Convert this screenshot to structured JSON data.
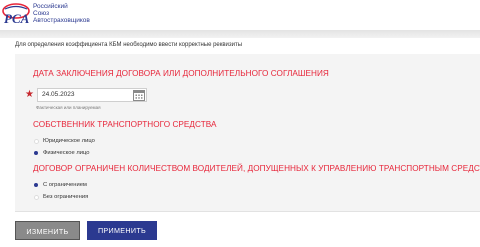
{
  "header": {
    "org_line1": "Российский",
    "org_line2": "Союз",
    "org_line3": "Автостраховщиков",
    "logo_colors": {
      "blue": "#2b3990",
      "red": "#e7263a"
    }
  },
  "intro_text": "Для определения коэффициента КБМ необходимо ввести корректные реквизиты",
  "section_contract": {
    "title": "ДАТА ЗАКЛЮЧЕНИЯ ДОГОВОРА ИЛИ ДОПОЛНИТЕЛЬНОГО СОГЛАШЕНИЯ",
    "required_mark": "★",
    "date_value": "24.05.2023",
    "date_hint": "Фактическая или планируемая"
  },
  "section_owner": {
    "title": "СОБСТВЕННИК ТРАНСПОРТНОГО СРЕДСТВА",
    "options": [
      {
        "label": "Юридическое лицо",
        "selected": false
      },
      {
        "label": "Физическое лицо",
        "selected": true
      }
    ]
  },
  "section_drivers": {
    "title": "ДОГОВОР ОГРАНИЧЕН КОЛИЧЕСТВОМ ВОДИТЕЛЕЙ, ДОПУЩЕННЫХ К УПРАВЛЕНИЮ ТРАНСПОРТНЫМ СРЕДСТВОМ",
    "options": [
      {
        "label": "С ограничением",
        "selected": true
      },
      {
        "label": "Без ограничения",
        "selected": false
      }
    ]
  },
  "buttons": {
    "change": "ИЗМЕНИТЬ",
    "apply": "ПРИМЕНИТЬ"
  },
  "colors": {
    "accent_red": "#e7263a",
    "brand_blue": "#2b3990",
    "button_gray": "#8a8a8a"
  }
}
